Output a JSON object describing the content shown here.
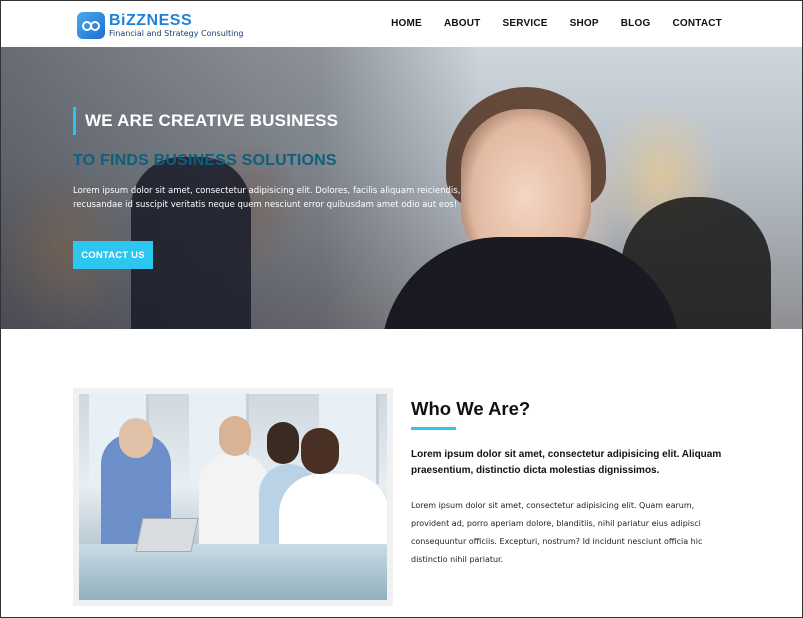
{
  "brand": {
    "name": "BiZZNESS",
    "tagline": "Financial and Strategy Consulting",
    "accent_color": "#1f82d6"
  },
  "nav": {
    "items": [
      "HOME",
      "ABOUT",
      "SERVICE",
      "SHOP",
      "BLOG",
      "CONTACT"
    ]
  },
  "hero": {
    "title": "WE ARE CREATIVE BUSINESS",
    "subtitle": "TO FINDS BUSINESS SOLUTIONS",
    "text": "Lorem ipsum dolor sit amet, consectetur adipisicing elit. Dolores, facilis aliquam reiciendis, recusandae id suscipit veritatis neque quem nesciunt error quibusdam amet odio aut eos!",
    "button_label": "CONTACT US",
    "button_color": "#2cc6f1"
  },
  "about": {
    "title": "Who We Are?",
    "lead": "Lorem ipsum dolor sit amet, consectetur adipisicing elit. Aliquam praesentium, distinctio dicta molestias dignissimos.",
    "body": "Lorem ipsum dolor sit amet, consectetur adipisicing elit. Quam earum, provident ad, porro aperiam dolore, blanditiis, nihil pariatur eius adipisci consequuntur officiis. Excepturi, nostrum? Id incidunt nesciunt officia hic distinctio nihil pariatur."
  }
}
